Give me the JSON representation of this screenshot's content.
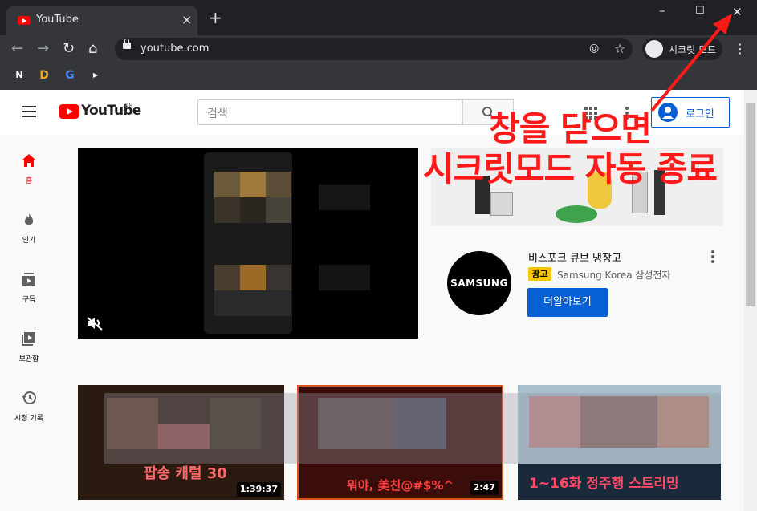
{
  "browser": {
    "tab_title": "YouTube",
    "tab_close": "×",
    "new_tab": "+",
    "window_controls": {
      "minimize": "–",
      "maximize": "☐",
      "close": "✕"
    },
    "url": "youtube.com",
    "incognito_label": "시크릿 모드",
    "bookmarks": [
      {
        "label": "N",
        "color": "#03c75a"
      },
      {
        "label": "D",
        "color": "#f5a623"
      },
      {
        "label": "G",
        "color": "#4285f4"
      },
      {
        "label": "▶",
        "color": "#ff0000"
      }
    ]
  },
  "youtube": {
    "logo_text": "YouTube",
    "region": "KR",
    "search_placeholder": "검색",
    "login_label": "로그인",
    "sidebar": [
      {
        "label": "홈",
        "icon": "home-icon",
        "active": true
      },
      {
        "label": "인기",
        "icon": "fire-icon"
      },
      {
        "label": "구독",
        "icon": "subscriptions-icon"
      },
      {
        "label": "보관함",
        "icon": "library-icon"
      },
      {
        "label": "시청 기록",
        "icon": "history-icon"
      }
    ],
    "ad": {
      "title": "비스포크 큐브 냉장고",
      "badge": "광고",
      "sponsor": "Samsung Korea 삼성전자",
      "cta": "더알아보기",
      "logo": "SAMSUNG"
    },
    "videos": [
      {
        "overlay_text": "팝송 캐럴 30",
        "duration": "1:39:37"
      },
      {
        "overlay_text": "뭐야, 美친@#$%^",
        "duration": "2:47"
      },
      {
        "overlay_text": "1~16화 정주행 스트리밍",
        "duration": ""
      }
    ]
  },
  "annotation": {
    "line1": "창을 닫으면",
    "line2": "시크릿모드 자동 종료",
    "color": "#ff1a1a"
  }
}
